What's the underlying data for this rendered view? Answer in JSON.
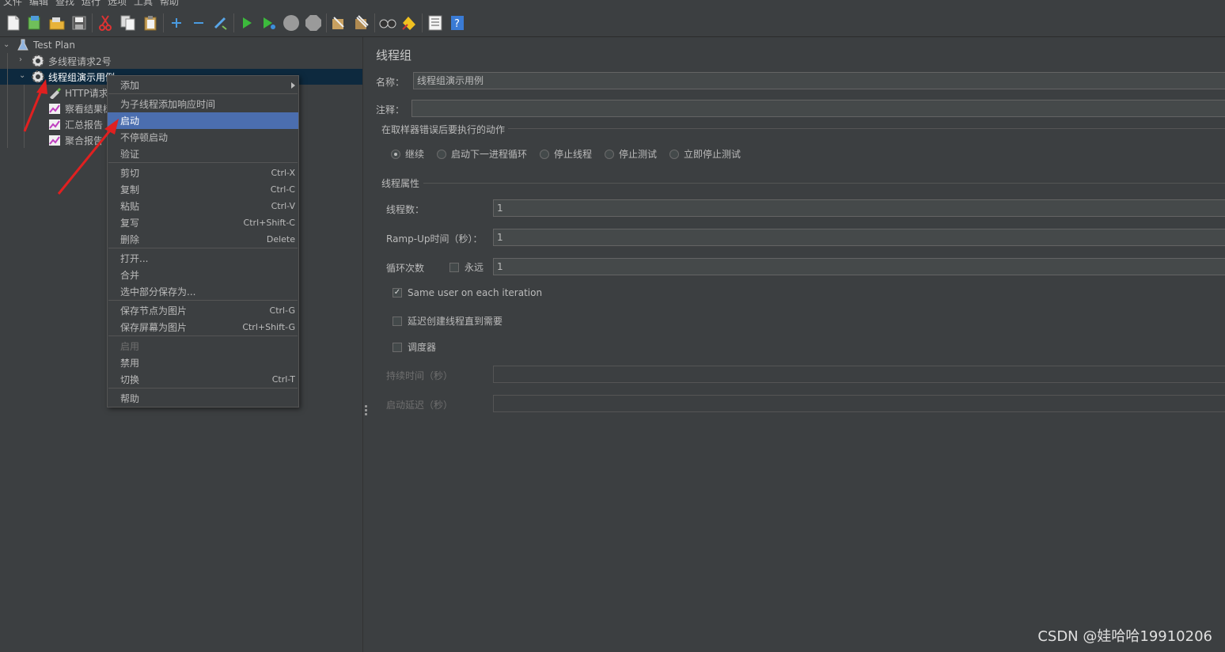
{
  "menubar": {
    "items": [
      "文件",
      "编辑",
      "查找",
      "运行",
      "选项",
      "工具",
      "帮助"
    ]
  },
  "toolbar": {
    "icons": [
      "new-icon",
      "templates-icon",
      "open-icon",
      "save-icon",
      "cut-icon",
      "copy-icon",
      "paste-icon",
      "expand-icon",
      "collapse-icon",
      "toggle-icon",
      "start-icon",
      "start-no-pauses-icon",
      "stop-icon",
      "shutdown-icon",
      "clear-icon",
      "clear-all-icon",
      "search-icon",
      "reset-search-icon",
      "function-helper-icon",
      "help-icon"
    ]
  },
  "tree": {
    "root": "Test Plan",
    "thread_group_1": "多线程请求2号",
    "thread_group_2": "线程组演示用例",
    "children": [
      "HTTP请求",
      "察看结果树",
      "汇总报告",
      "聚合报告"
    ]
  },
  "context_menu": {
    "add": "添加",
    "add_think_times": "为子线程添加响应时间",
    "start": "启动",
    "start_no_pauses": "不停顿启动",
    "validate": "验证",
    "cut": "剪切",
    "cut_sc": "Ctrl-X",
    "copy": "复制",
    "copy_sc": "Ctrl-C",
    "paste": "粘贴",
    "paste_sc": "Ctrl-V",
    "duplicate": "复写",
    "duplicate_sc": "Ctrl+Shift-C",
    "delete": "删除",
    "delete_sc": "Delete",
    "open": "打开...",
    "merge": "合并",
    "save_selection": "选中部分保存为...",
    "save_node_image": "保存节点为图片",
    "save_node_image_sc": "Ctrl-G",
    "save_screen_image": "保存屏幕为图片",
    "save_screen_image_sc": "Ctrl+Shift-G",
    "enable": "启用",
    "disable": "禁用",
    "toggle": "切换",
    "toggle_sc": "Ctrl-T",
    "help": "帮助"
  },
  "panel": {
    "title": "线程组",
    "name_label": "名称：",
    "name_value": "线程组演示用例",
    "comment_label": "注释：",
    "comment_value": "",
    "error_action_title": "在取样器错误后要执行的动作",
    "error_actions": [
      "继续",
      "启动下一进程循环",
      "停止线程",
      "停止测试",
      "立即停止测试"
    ],
    "selected_error_action": "继续",
    "thread_props_title": "线程属性",
    "threads_label": "线程数：",
    "threads_value": "1",
    "rampup_label": "Ramp-Up时间（秒）：",
    "rampup_value": "1",
    "loop_label": "循环次数",
    "forever_label": "永远",
    "loop_value": "1",
    "same_user_label": "Same user on each iteration",
    "same_user_checked": true,
    "delay_create_label": "延迟创建线程直到需要",
    "scheduler_label": "调度器",
    "duration_label": "持续时间（秒）",
    "startup_delay_label": "启动延迟（秒）"
  },
  "watermark": "CSDN @娃哈哈19910206",
  "colors": {
    "background": "#3c3f41",
    "selection": "#4b6eaf",
    "tree_selection": "#0d293e",
    "annotation_arrow": "#e02020"
  }
}
